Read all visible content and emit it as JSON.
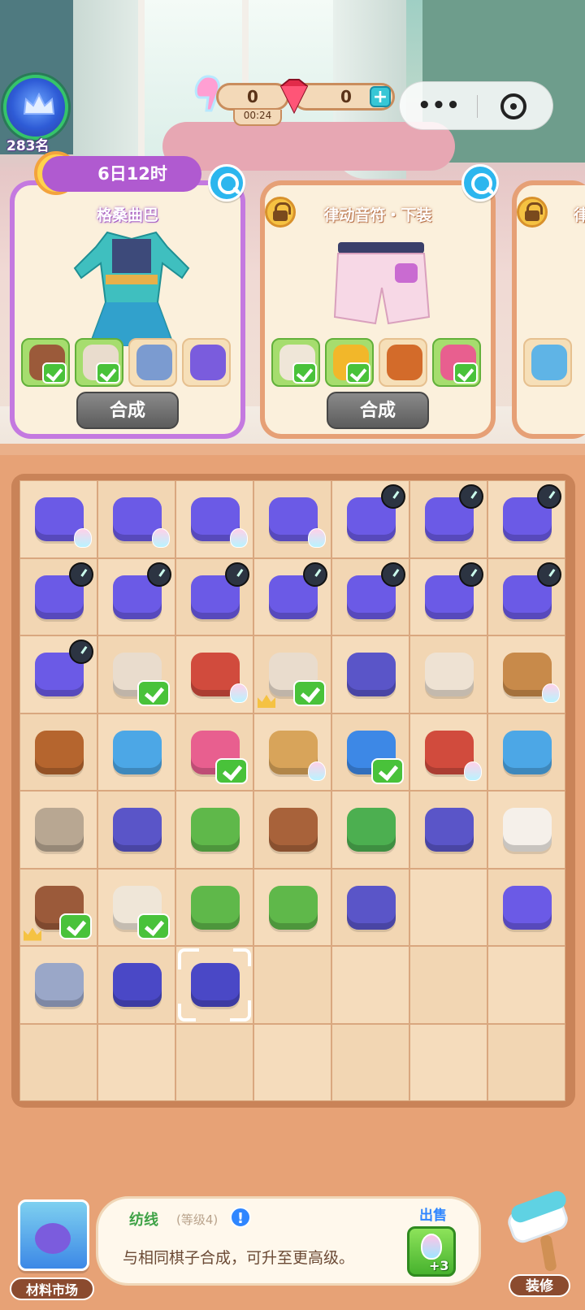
{
  "hud": {
    "rank": "283名",
    "energy_value": "0",
    "energy_timer": "00:24",
    "gem_value": "0",
    "plus_label": "+"
  },
  "orders": [
    {
      "title": "格桑曲巴",
      "timer": "6日12时",
      "locked": false,
      "craft_label": "合成",
      "materials": [
        {
          "name": "bag",
          "done": true,
          "color": "#9b5a3a"
        },
        {
          "name": "towel-roll",
          "done": true,
          "color": "#e9dccd"
        },
        {
          "name": "stone-block",
          "done": false,
          "color": "#7b9bd0"
        },
        {
          "name": "sewing-machine",
          "done": false,
          "color": "#7a5cdd"
        }
      ]
    },
    {
      "title": "律动音符・下装",
      "locked": true,
      "craft_label": "合成",
      "materials": [
        {
          "name": "towel",
          "done": true,
          "color": "#efe6d8"
        },
        {
          "name": "gold-bars",
          "done": true,
          "color": "#f2b72a"
        },
        {
          "name": "wood-bundle",
          "done": false,
          "color": "#d36b2a"
        },
        {
          "name": "sewing-machine-pink",
          "done": true,
          "color": "#e85f8f"
        }
      ]
    },
    {
      "title": "律",
      "locked": true,
      "materials": [
        {
          "name": "fabric-stack",
          "done": false,
          "color": "#5fb4e6"
        }
      ]
    }
  ],
  "board": {
    "rows": [
      [
        {
          "piece": "sewing-box",
          "color": "#6b5ae6",
          "badge": "spark"
        },
        {
          "piece": "sewing-box",
          "color": "#6b5ae6",
          "badge": "spark"
        },
        {
          "piece": "sewing-box",
          "color": "#6b5ae6",
          "badge": "spark"
        },
        {
          "piece": "sewing-box",
          "color": "#6b5ae6",
          "badge": "spark"
        },
        {
          "piece": "sewing-box",
          "color": "#6b5ae6",
          "badge": "timer"
        },
        {
          "piece": "sewing-box",
          "color": "#6b5ae6",
          "badge": "timer"
        },
        {
          "piece": "sewing-box",
          "color": "#6b5ae6",
          "badge": "timer"
        }
      ],
      [
        {
          "piece": "sewing-box",
          "color": "#6b5ae6",
          "badge": "timer"
        },
        {
          "piece": "sewing-box",
          "color": "#6b5ae6",
          "badge": "timer"
        },
        {
          "piece": "sewing-box",
          "color": "#6b5ae6",
          "badge": "timer"
        },
        {
          "piece": "sewing-box",
          "color": "#6b5ae6",
          "badge": "timer"
        },
        {
          "piece": "sewing-box",
          "color": "#6b5ae6",
          "badge": "timer"
        },
        {
          "piece": "sewing-box",
          "color": "#6b5ae6",
          "badge": "timer"
        },
        {
          "piece": "sewing-box",
          "color": "#6b5ae6",
          "badge": "timer"
        }
      ],
      [
        {
          "piece": "sewing-box",
          "color": "#6b5ae6",
          "badge": "timer"
        },
        {
          "piece": "towel-roll-bundle",
          "color": "#e9dccd",
          "badge": "check"
        },
        {
          "piece": "wood-bundle-box",
          "color": "#d14b3d",
          "badge": "spark"
        },
        {
          "piece": "towel-basket",
          "color": "#e9dccd",
          "badge": "check-crown"
        },
        {
          "piece": "sewing-machine",
          "color": "#5a55c8",
          "badge": ""
        },
        {
          "piece": "cotton-roll",
          "color": "#eee2d3",
          "badge": ""
        },
        {
          "piece": "sprout-crate",
          "color": "#c88a4a",
          "badge": "spark"
        }
      ],
      [
        {
          "piece": "wood-planks",
          "color": "#b5652e",
          "badge": ""
        },
        {
          "piece": "stone-bucket",
          "color": "#4ca7e6",
          "badge": ""
        },
        {
          "piece": "pink-sewing-machine",
          "color": "#e85f8f",
          "badge": "check"
        },
        {
          "piece": "seed-sack",
          "color": "#d8a45a",
          "badge": "spark"
        },
        {
          "piece": "gold-crate",
          "color": "#3d88e6",
          "badge": "check"
        },
        {
          "piece": "wood-bundle-box",
          "color": "#d14b3d",
          "badge": "spark"
        },
        {
          "piece": "stone-cart",
          "color": "#4ca7e6",
          "badge": ""
        }
      ],
      [
        {
          "piece": "stones",
          "color": "#b8a792",
          "badge": ""
        },
        {
          "piece": "thread-spinner",
          "color": "#5a55c8",
          "badge": ""
        },
        {
          "piece": "seed-leaf",
          "color": "#5fb84a",
          "badge": ""
        },
        {
          "piece": "cotton-crate",
          "color": "#a8623a",
          "badge": ""
        },
        {
          "piece": "soil-bowl",
          "color": "#4caf50",
          "badge": ""
        },
        {
          "piece": "loom",
          "color": "#5a55c8",
          "badge": ""
        },
        {
          "piece": "cotton",
          "color": "#f5f0ea",
          "badge": ""
        }
      ],
      [
        {
          "piece": "bag",
          "color": "#9b5a3a",
          "badge": "check-crown"
        },
        {
          "piece": "towel-roll",
          "color": "#efe6d8",
          "badge": "check"
        },
        {
          "piece": "sprout-pot",
          "color": "#5fb84a",
          "badge": ""
        },
        {
          "piece": "flower-pot",
          "color": "#5fb84a",
          "badge": ""
        },
        {
          "piece": "yarn-basket",
          "color": "#5a55c8",
          "badge": ""
        },
        {
          "piece": "",
          "color": "",
          "badge": ""
        },
        {
          "piece": "yarn-ball",
          "color": "#6b5ae6",
          "badge": ""
        }
      ],
      [
        {
          "piece": "needle",
          "color": "#9aa7c8",
          "badge": ""
        },
        {
          "piece": "thread-roll",
          "color": "#4a48c6",
          "badge": ""
        },
        {
          "piece": "thread-spool",
          "color": "#4a48c6",
          "badge": "selected"
        },
        {
          "piece": "",
          "color": "",
          "badge": ""
        },
        {
          "piece": "",
          "color": "",
          "badge": ""
        },
        {
          "piece": "",
          "color": "",
          "badge": ""
        },
        {
          "piece": "",
          "color": "",
          "badge": ""
        }
      ],
      [
        {
          "piece": "",
          "color": "",
          "badge": ""
        },
        {
          "piece": "",
          "color": "",
          "badge": ""
        },
        {
          "piece": "",
          "color": "",
          "badge": ""
        },
        {
          "piece": "",
          "color": "",
          "badge": ""
        },
        {
          "piece": "",
          "color": "",
          "badge": ""
        },
        {
          "piece": "",
          "color": "",
          "badge": ""
        },
        {
          "piece": "",
          "color": "",
          "badge": ""
        }
      ]
    ]
  },
  "info": {
    "name": "纺线",
    "level": "(等级4)",
    "alert": "!",
    "description": "与相同棋子合成，可升至更高级。",
    "sell_label": "出售",
    "sell_amount": "+3"
  },
  "nav": {
    "market_label": "材料市场",
    "decorate_label": "装修"
  },
  "colors": {
    "accent_purple": "#c479e0",
    "board_bg": "#e7a276",
    "check_green": "#49c23a",
    "sell_blue": "#2f86ff"
  }
}
